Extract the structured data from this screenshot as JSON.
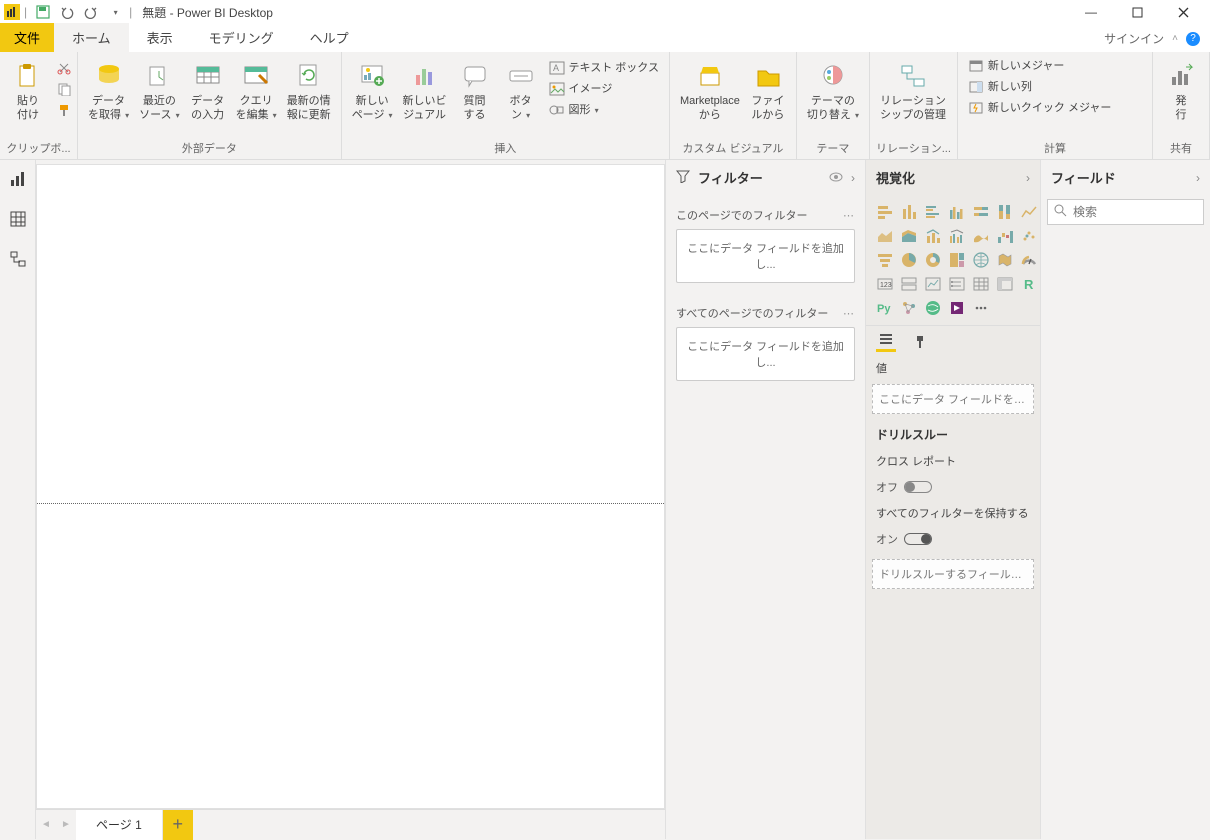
{
  "title": "無題 - Power BI Desktop",
  "tabs": {
    "file": "文件",
    "home": "ホーム",
    "view": "表示",
    "modeling": "モデリング",
    "help": "ヘルプ",
    "signin": "サインイン"
  },
  "ribbon": {
    "clipboard": {
      "label": "クリップボ...",
      "paste": "貼り\n付け"
    },
    "external": {
      "label": "外部データ",
      "getdata": "データ\nを取得",
      "recent": "最近の\nソース",
      "enter": "データ\nの入力",
      "edit": "クエリ\nを編集",
      "refresh": "最新の情\n報に更新"
    },
    "insert": {
      "label": "挿入",
      "newpage": "新しい\nページ",
      "newvisual": "新しいビ\nジュアル",
      "question": "質問\nする",
      "button": "ボタ\nン",
      "textbox": "テキスト ボックス",
      "image": "イメージ",
      "shape": "図形"
    },
    "custom": {
      "label": "カスタム ビジュアル",
      "market": "Marketplace\nから",
      "file": "ファイ\nルから"
    },
    "theme": {
      "label": "テーマ",
      "switch": "テーマの\n切り替え"
    },
    "relation": {
      "label": "リレーション...",
      "manage": "リレーション\nシップの管理"
    },
    "calc": {
      "label": "計算",
      "newmeasure": "新しいメジャー",
      "newcol": "新しい列",
      "newquick": "新しいクイック メジャー"
    },
    "share": {
      "label": "共有",
      "publish": "発\n行"
    }
  },
  "filters": {
    "title": "フィルター",
    "page": "このページでのフィルター",
    "all": "すべてのページでのフィルター",
    "drop": "ここにデータ フィールドを追加し..."
  },
  "viz": {
    "title": "視覚化",
    "value": "値",
    "dropvalue": "ここにデータ フィールドを追加して...",
    "drill": "ドリルスルー",
    "cross": "クロス レポート",
    "off": "オフ",
    "keepall": "すべてのフィルターを保持する",
    "on": "オン",
    "dropdrill": "ドリルスルーするフィールドをここ..."
  },
  "fields": {
    "title": "フィールド",
    "search": "検索"
  },
  "page": {
    "name": "ページ 1"
  }
}
